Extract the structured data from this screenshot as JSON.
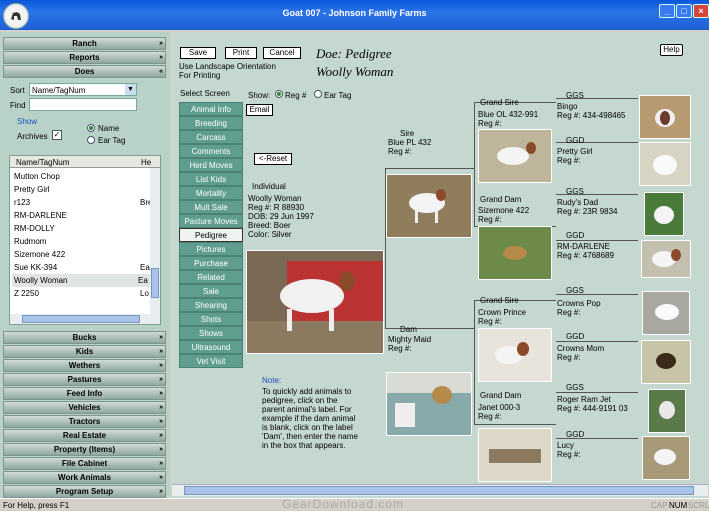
{
  "window": {
    "title": "Goat 007 - Johnson Family Farms"
  },
  "left": {
    "top_sections": [
      "Ranch",
      "Reports",
      "Does"
    ],
    "sort_label": "Sort",
    "sort_value": "Name/TagNum",
    "find_label": "Find",
    "find_value": "",
    "show_label": "Show",
    "archives_label": "Archives",
    "archives_checked": true,
    "radio_name": "Name",
    "radio_eartag": "Ear Tag",
    "list_headers": [
      "Name/TagNum",
      "He"
    ],
    "list_rows": [
      {
        "name": "Mutton Chop",
        "extra": ""
      },
      {
        "name": "Pretty Girl",
        "extra": ""
      },
      {
        "name": "r123",
        "extra": "Bre"
      },
      {
        "name": "RM-DARLENE",
        "extra": ""
      },
      {
        "name": "RM-DOLLY",
        "extra": ""
      },
      {
        "name": "Rudmom",
        "extra": ""
      },
      {
        "name": "Sizemone 422",
        "extra": ""
      },
      {
        "name": "Sue KK-394",
        "extra": "Ea"
      },
      {
        "name": "Woolly Woman",
        "extra": "Ea"
      },
      {
        "name": "Z 2250",
        "extra": "Lo"
      }
    ],
    "bottom_sections": [
      "Bucks",
      "Kids",
      "Wethers",
      "Pastures",
      "Feed Info",
      "Vehicles",
      "Tractors",
      "Real Estate",
      "Property (Items)",
      "File Cabinet",
      "Work Animals",
      "Program Setup"
    ]
  },
  "toolbar": {
    "save": "Save",
    "print": "Print",
    "cancel": "Cancel",
    "help": "Help",
    "note": "Use Landscape Orientation\nFor Printing"
  },
  "heading": {
    "line1": "Doe: Pedigree",
    "line2": "Woolly Woman"
  },
  "select_screen_label": "Select Screen",
  "screens": [
    "Animal Info",
    "Breeding",
    "Carcass",
    "Comments",
    "Herd Moves",
    "List Kids",
    "Mortality",
    "Mult Sale",
    "Pasture Moves",
    "Pedigree",
    "Pictures",
    "Purchase",
    "Related",
    "Sale",
    "Shearing",
    "Shots",
    "Shows",
    "Ultrasound",
    "Vet Visit"
  ],
  "active_screen": "Pedigree",
  "show": {
    "label": "Show:",
    "reg": "Reg #",
    "eartag": "Ear Tag",
    "email": "Email",
    "reset": "<-Reset"
  },
  "individual": {
    "label": "Individual",
    "name": "Woolly Woman",
    "reg": "Reg #: R 88930",
    "dob": "DOB: 29 Jun 1997",
    "breed": "Breed: Boer",
    "color": "Color: Silver"
  },
  "sire": {
    "label": "Sire",
    "name": "Blue PL 432",
    "reg": "Reg #:"
  },
  "dam": {
    "label": "Dam",
    "name": "Mighty Maid",
    "reg": "Reg #:"
  },
  "grand_sire_1": {
    "label": "Grand Sire",
    "name": "Blue OL 432-991",
    "reg": "Reg #:"
  },
  "grand_dam_1": {
    "label": "Grand Dam",
    "name": "Sizemone 422",
    "reg": "Reg #:"
  },
  "grand_sire_2": {
    "label": "Grand Sire",
    "name": "Crown Prince",
    "reg": "Reg #:"
  },
  "grand_dam_2": {
    "label": "Grand Dam",
    "name": "Janet 000-3",
    "reg": "Reg #:"
  },
  "ggs1": {
    "label": "GGS",
    "name": "Bingo",
    "reg": "Reg #: 434-498465"
  },
  "ggd1": {
    "label": "GGD",
    "name": "Pretty Girl",
    "reg": "Reg #:"
  },
  "ggs2": {
    "label": "GGS",
    "name": "Rudy's Dad",
    "reg": "Reg #: 23R 9834"
  },
  "ggd2": {
    "label": "GGD",
    "name": "RM-DARLENE",
    "reg": "Reg #: 4768689"
  },
  "ggs3": {
    "label": "GGS",
    "name": "Crowns Pop",
    "reg": "Reg #:"
  },
  "ggd3": {
    "label": "GGD",
    "name": "Crowns Mom",
    "reg": "Reg #:"
  },
  "ggs4": {
    "label": "GGS",
    "name": "Roger Ram Jet",
    "reg": "Reg #: 444-9191 03"
  },
  "ggd4": {
    "label": "GGD",
    "name": "Lucy",
    "reg": "Reg #:"
  },
  "note": {
    "title": "Note:",
    "body": "To quickly add animals to\npedigree, click on the\nparent animal's label. For\nexample if the dam animal\nis blank, click on the label\n'Dam', then enter the name\nin the box that appears."
  },
  "status": {
    "help": "For Help, press F1",
    "watermark": "GearDownload.com",
    "cap": "CAP",
    "num": "NUM",
    "scrl": "SCRL"
  }
}
